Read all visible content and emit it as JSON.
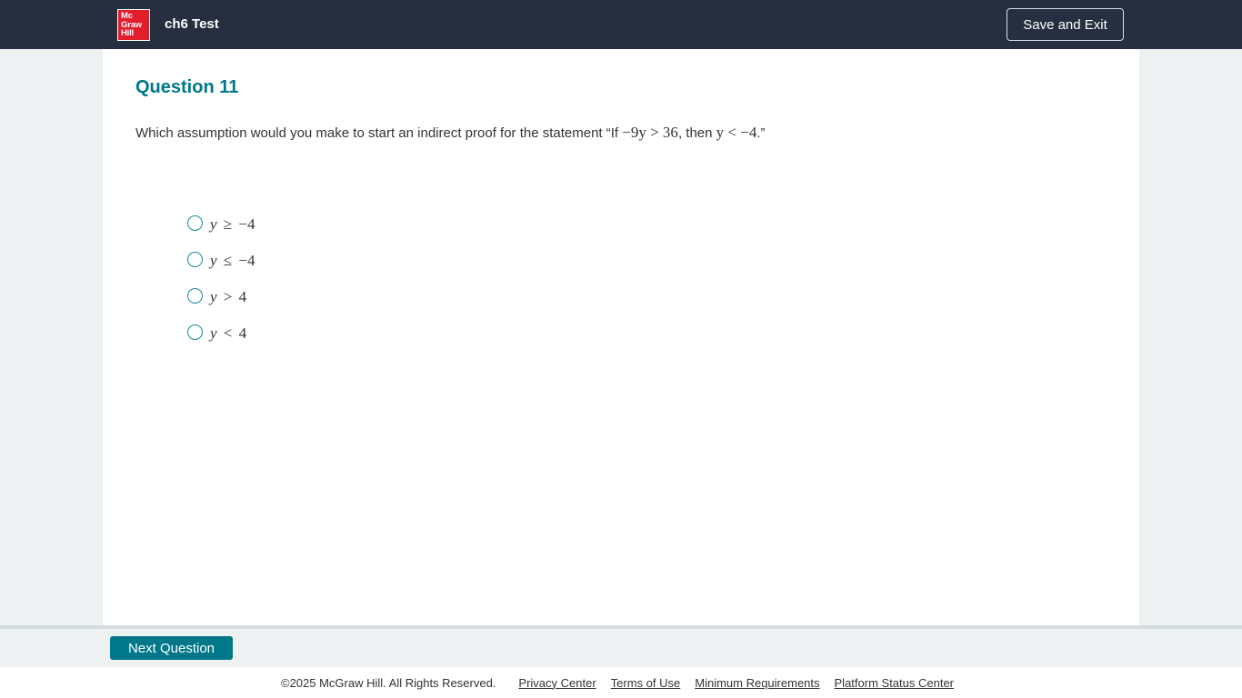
{
  "header": {
    "logo_lines": [
      "Mc",
      "Graw",
      "Hill"
    ],
    "title": "ch6 Test",
    "save_exit_label": "Save and Exit"
  },
  "question": {
    "title": "Question 11",
    "prompt_prefix": "Which assumption would you make to start an indirect proof for the statement “If ",
    "prompt_math1": "−9y > 36",
    "prompt_middle": ", then ",
    "prompt_math2": "y < −4",
    "prompt_suffix": ".”",
    "options": [
      {
        "label": "y ≥ −4",
        "var": "y",
        "rest": " ≥ −4",
        "selected": false
      },
      {
        "label": "y ≤ −4",
        "var": "y",
        "rest": " ≤ −4",
        "selected": false
      },
      {
        "label": "y > 4",
        "var": "y",
        "rest": " > 4",
        "selected": false
      },
      {
        "label": "y < 4",
        "var": "y",
        "rest": " < 4",
        "selected": false
      }
    ]
  },
  "navigation": {
    "next_label": "Next Question"
  },
  "footer": {
    "copyright": "©2025 McGraw Hill. All Rights Reserved.",
    "links": [
      "Privacy Center",
      "Terms of Use",
      "Minimum Requirements",
      "Platform Status Center"
    ]
  },
  "colors": {
    "topbar": "#262f40",
    "accent": "#00788a",
    "brand_red": "#e21d2c"
  }
}
